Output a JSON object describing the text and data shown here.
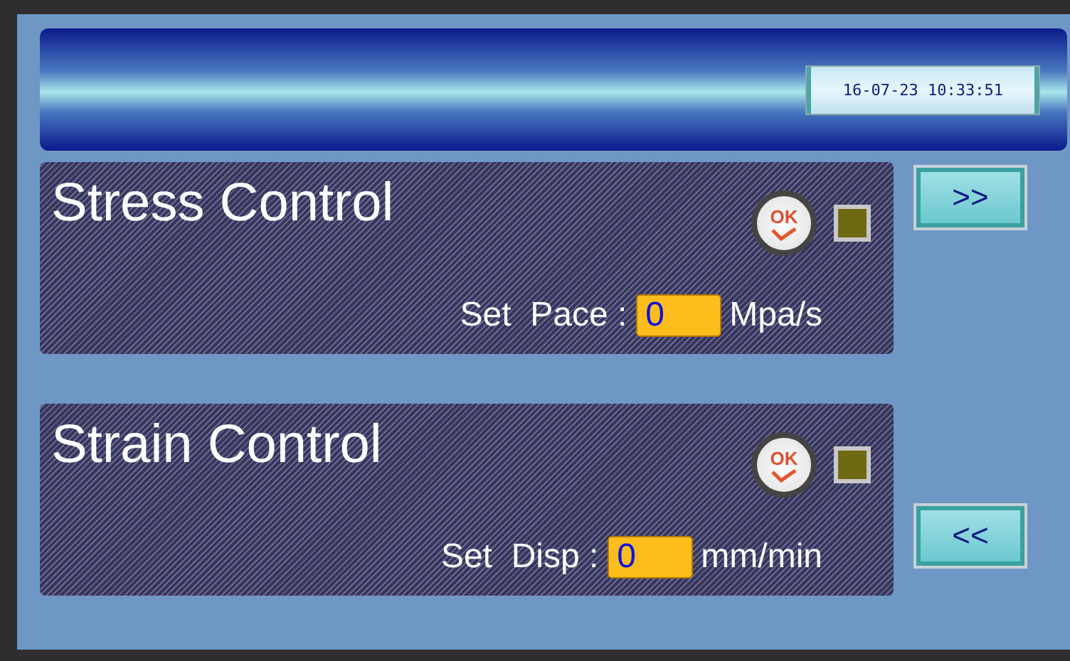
{
  "header": {
    "clock": "16-07-23 10:33:51"
  },
  "panels": [
    {
      "title": "Stress Control",
      "ok_label": "OK",
      "indicator_on": false,
      "field_label": "Set  Pace :",
      "value": "0",
      "unit": "Mpa/s"
    },
    {
      "title": "Strain Control",
      "ok_label": "OK",
      "indicator_on": false,
      "field_label": "Set  Disp :",
      "value": "0",
      "unit": "mm/min"
    }
  ],
  "nav_buttons": [
    ">>",
    "<<"
  ]
}
